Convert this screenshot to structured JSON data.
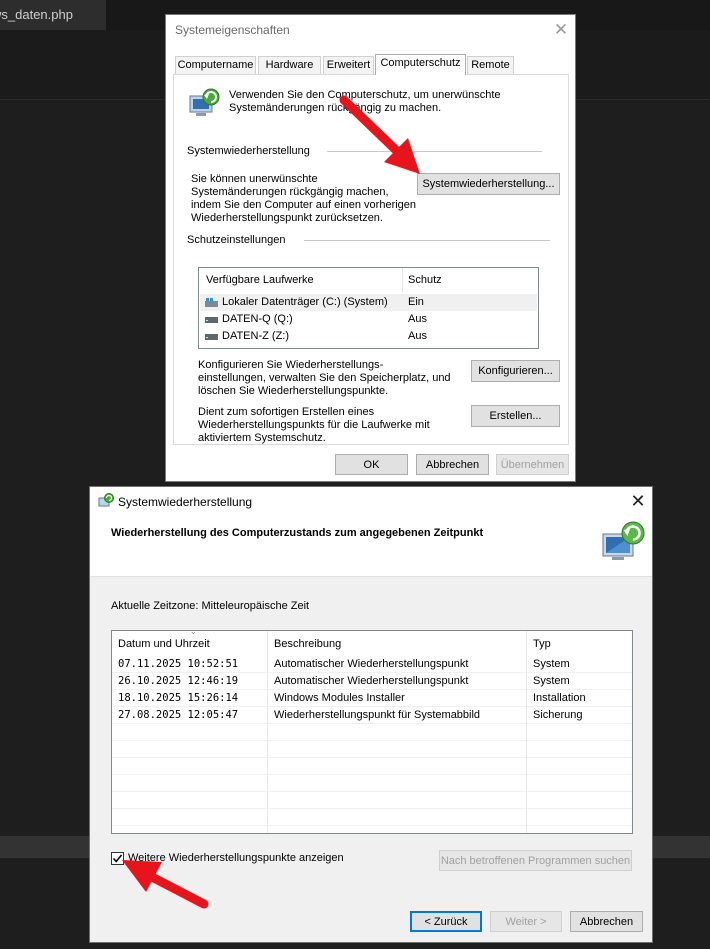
{
  "editor": {
    "tab_label": "ws_daten.php"
  },
  "properties_dialog": {
    "title": "Systemeigenschaften",
    "tabs": [
      {
        "label": "Computername",
        "active": false
      },
      {
        "label": "Hardware",
        "active": false
      },
      {
        "label": "Erweitert",
        "active": false
      },
      {
        "label": "Computerschutz",
        "active": true
      },
      {
        "label": "Remote",
        "active": false
      }
    ],
    "intro_line1": "Verwenden Sie den Computerschutz, um unerwünschte",
    "intro_line2": "Systemänderungen rückgängig zu machen.",
    "restore_section": {
      "heading": "Systemwiederherstellung",
      "text_line1": "Sie können unerwünschte",
      "text_line2": "Systemänderungen rückgängig machen,",
      "text_line3": "indem Sie den Computer auf einen vorherigen",
      "text_line4": "Wiederherstellungspunkt zurücksetzen.",
      "button_label": "Systemwiederherstellung..."
    },
    "protection_section": {
      "heading": "Schutzeinstellungen",
      "col_drives": "Verfügbare Laufwerke",
      "col_protection": "Schutz",
      "drives": [
        {
          "name": "Lokaler Datenträger (C:) (System)",
          "protection": "Ein",
          "icon": "system-drive-icon"
        },
        {
          "name": "DATEN-Q (Q:)",
          "protection": "Aus",
          "icon": "hard-drive-icon"
        },
        {
          "name": "DATEN-Z (Z:)",
          "protection": "Aus",
          "icon": "hard-drive-icon"
        }
      ],
      "configure_line1": "Konfigurieren Sie Wiederherstellungs-",
      "configure_line2": "einstellungen, verwalten Sie den Speicherplatz, und",
      "configure_line3": "löschen Sie Wiederherstellungspunkte.",
      "configure_button": "Konfigurieren...",
      "create_line1": "Dient zum sofortigen Erstellen eines",
      "create_line2": "Wiederherstellungspunkts für die Laufwerke mit",
      "create_line3": "aktiviertem Systemschutz.",
      "create_button": "Erstellen..."
    },
    "buttons": {
      "ok": "OK",
      "cancel": "Abbrechen",
      "apply": "Übernehmen"
    }
  },
  "restore_dialog": {
    "title": "Systemwiederherstellung",
    "heading": "Wiederherstellung des Computerzustands zum angegebenen Zeitpunkt",
    "timezone": "Aktuelle Zeitzone: Mitteleuropäische Zeit",
    "columns": {
      "date": "Datum und Uhrzeit",
      "description": "Beschreibung",
      "type": "Typ"
    },
    "restore_points": [
      {
        "date": "07.11.2025 10:52:51",
        "description": "Automatischer Wiederherstellungspunkt",
        "type": "System"
      },
      {
        "date": "26.10.2025 12:46:19",
        "description": "Automatischer Wiederherstellungspunkt",
        "type": "System"
      },
      {
        "date": "18.10.2025 15:26:14",
        "description": "Windows Modules Installer",
        "type": "Installation"
      },
      {
        "date": "27.08.2025 12:05:47",
        "description": "Wiederherstellungspunkt für Systemabbild",
        "type": "Sicherung"
      }
    ],
    "show_more_label": "Weitere Wiederherstellungspunkte anzeigen",
    "show_more_checked": true,
    "scan_button": "Nach betroffenen Programmen suchen",
    "back_button": "< Zurück",
    "next_button": "Weiter >",
    "cancel_button": "Abbrechen"
  },
  "colors": {
    "annotation_arrow": "#e8141b",
    "focus": "#0078d7"
  }
}
